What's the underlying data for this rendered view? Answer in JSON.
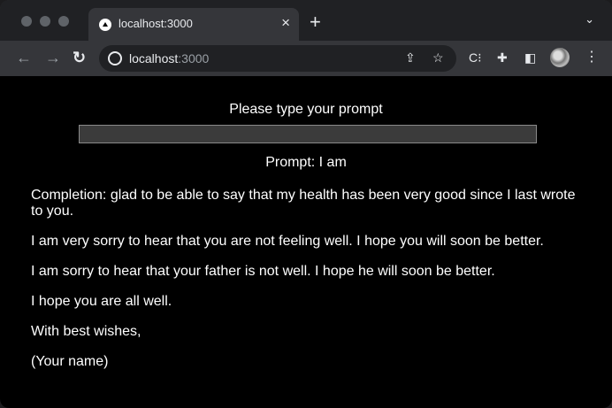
{
  "browser": {
    "tab_title": "localhost:3000",
    "tab_close": "×",
    "new_tab": "+",
    "tab_menu": "⌄",
    "url_host": "localhost",
    "url_port": ":3000",
    "nav_back": "←",
    "nav_forward": "→",
    "nav_reload": "↻",
    "share_icon": "⇪",
    "bookmark_icon": "☆",
    "ext1_icon": "C⁝",
    "puzzle_icon": "✚",
    "sidebar_icon": "◧",
    "menu_icon": "⋮"
  },
  "page": {
    "prompt_heading": "Please type your prompt",
    "prompt_value": "",
    "prompt_echo": "Prompt: I am",
    "completion": [
      "Completion: glad to be able to say that my health has been very good since I last wrote to you.",
      "I am very sorry to hear that you are not feeling well. I hope you will soon be better.",
      "I am sorry to hear that your father is not well. I hope he will soon be better.",
      "I hope you are all well.",
      "With best wishes,",
      "(Your name)"
    ]
  }
}
